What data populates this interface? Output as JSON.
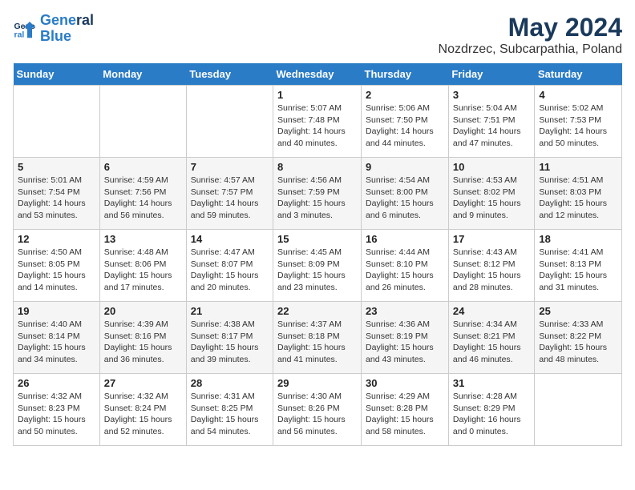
{
  "logo": {
    "line1": "General",
    "line2": "Blue"
  },
  "title": "May 2024",
  "subtitle": "Nozdrzec, Subcarpathia, Poland",
  "days_of_week": [
    "Sunday",
    "Monday",
    "Tuesday",
    "Wednesday",
    "Thursday",
    "Friday",
    "Saturday"
  ],
  "weeks": [
    [
      {
        "day": "",
        "info": ""
      },
      {
        "day": "",
        "info": ""
      },
      {
        "day": "",
        "info": ""
      },
      {
        "day": "1",
        "info": "Sunrise: 5:07 AM\nSunset: 7:48 PM\nDaylight: 14 hours\nand 40 minutes."
      },
      {
        "day": "2",
        "info": "Sunrise: 5:06 AM\nSunset: 7:50 PM\nDaylight: 14 hours\nand 44 minutes."
      },
      {
        "day": "3",
        "info": "Sunrise: 5:04 AM\nSunset: 7:51 PM\nDaylight: 14 hours\nand 47 minutes."
      },
      {
        "day": "4",
        "info": "Sunrise: 5:02 AM\nSunset: 7:53 PM\nDaylight: 14 hours\nand 50 minutes."
      }
    ],
    [
      {
        "day": "5",
        "info": "Sunrise: 5:01 AM\nSunset: 7:54 PM\nDaylight: 14 hours\nand 53 minutes."
      },
      {
        "day": "6",
        "info": "Sunrise: 4:59 AM\nSunset: 7:56 PM\nDaylight: 14 hours\nand 56 minutes."
      },
      {
        "day": "7",
        "info": "Sunrise: 4:57 AM\nSunset: 7:57 PM\nDaylight: 14 hours\nand 59 minutes."
      },
      {
        "day": "8",
        "info": "Sunrise: 4:56 AM\nSunset: 7:59 PM\nDaylight: 15 hours\nand 3 minutes."
      },
      {
        "day": "9",
        "info": "Sunrise: 4:54 AM\nSunset: 8:00 PM\nDaylight: 15 hours\nand 6 minutes."
      },
      {
        "day": "10",
        "info": "Sunrise: 4:53 AM\nSunset: 8:02 PM\nDaylight: 15 hours\nand 9 minutes."
      },
      {
        "day": "11",
        "info": "Sunrise: 4:51 AM\nSunset: 8:03 PM\nDaylight: 15 hours\nand 12 minutes."
      }
    ],
    [
      {
        "day": "12",
        "info": "Sunrise: 4:50 AM\nSunset: 8:05 PM\nDaylight: 15 hours\nand 14 minutes."
      },
      {
        "day": "13",
        "info": "Sunrise: 4:48 AM\nSunset: 8:06 PM\nDaylight: 15 hours\nand 17 minutes."
      },
      {
        "day": "14",
        "info": "Sunrise: 4:47 AM\nSunset: 8:07 PM\nDaylight: 15 hours\nand 20 minutes."
      },
      {
        "day": "15",
        "info": "Sunrise: 4:45 AM\nSunset: 8:09 PM\nDaylight: 15 hours\nand 23 minutes."
      },
      {
        "day": "16",
        "info": "Sunrise: 4:44 AM\nSunset: 8:10 PM\nDaylight: 15 hours\nand 26 minutes."
      },
      {
        "day": "17",
        "info": "Sunrise: 4:43 AM\nSunset: 8:12 PM\nDaylight: 15 hours\nand 28 minutes."
      },
      {
        "day": "18",
        "info": "Sunrise: 4:41 AM\nSunset: 8:13 PM\nDaylight: 15 hours\nand 31 minutes."
      }
    ],
    [
      {
        "day": "19",
        "info": "Sunrise: 4:40 AM\nSunset: 8:14 PM\nDaylight: 15 hours\nand 34 minutes."
      },
      {
        "day": "20",
        "info": "Sunrise: 4:39 AM\nSunset: 8:16 PM\nDaylight: 15 hours\nand 36 minutes."
      },
      {
        "day": "21",
        "info": "Sunrise: 4:38 AM\nSunset: 8:17 PM\nDaylight: 15 hours\nand 39 minutes."
      },
      {
        "day": "22",
        "info": "Sunrise: 4:37 AM\nSunset: 8:18 PM\nDaylight: 15 hours\nand 41 minutes."
      },
      {
        "day": "23",
        "info": "Sunrise: 4:36 AM\nSunset: 8:19 PM\nDaylight: 15 hours\nand 43 minutes."
      },
      {
        "day": "24",
        "info": "Sunrise: 4:34 AM\nSunset: 8:21 PM\nDaylight: 15 hours\nand 46 minutes."
      },
      {
        "day": "25",
        "info": "Sunrise: 4:33 AM\nSunset: 8:22 PM\nDaylight: 15 hours\nand 48 minutes."
      }
    ],
    [
      {
        "day": "26",
        "info": "Sunrise: 4:32 AM\nSunset: 8:23 PM\nDaylight: 15 hours\nand 50 minutes."
      },
      {
        "day": "27",
        "info": "Sunrise: 4:32 AM\nSunset: 8:24 PM\nDaylight: 15 hours\nand 52 minutes."
      },
      {
        "day": "28",
        "info": "Sunrise: 4:31 AM\nSunset: 8:25 PM\nDaylight: 15 hours\nand 54 minutes."
      },
      {
        "day": "29",
        "info": "Sunrise: 4:30 AM\nSunset: 8:26 PM\nDaylight: 15 hours\nand 56 minutes."
      },
      {
        "day": "30",
        "info": "Sunrise: 4:29 AM\nSunset: 8:28 PM\nDaylight: 15 hours\nand 58 minutes."
      },
      {
        "day": "31",
        "info": "Sunrise: 4:28 AM\nSunset: 8:29 PM\nDaylight: 16 hours\nand 0 minutes."
      },
      {
        "day": "",
        "info": ""
      }
    ]
  ]
}
